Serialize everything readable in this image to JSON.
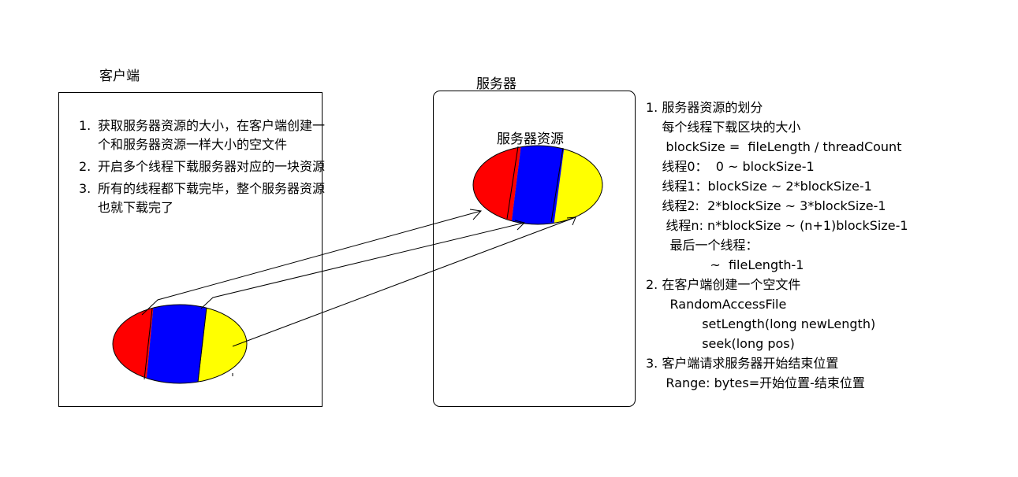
{
  "client": {
    "title": "客户端",
    "steps": [
      {
        "num": "1.",
        "text": "获取服务器资源的大小，在客户端创建一个和服务器资源一样大小的空文件"
      },
      {
        "num": "2.",
        "text": "开启多个线程下载服务器对应的一块资源"
      },
      {
        "num": "3.",
        "text": "所有的线程都下载完毕，整个服务器资源也就下载完了"
      }
    ]
  },
  "server": {
    "title": "服务器",
    "resource_label": "服务器资源"
  },
  "colors": {
    "segment1": "#ff0000",
    "segment2": "#0000ff",
    "segment3": "#ffff00"
  },
  "notes": [
    "1. 服务器资源的划分",
    "    每个线程下载区块的大小",
    "     blockSize =  fileLength / threadCount",
    "    线程0：  0 ~ blockSize-1",
    "    线程1：blockSize ~ 2*blockSize-1",
    "    线程2:  2*blockSize ~ 3*blockSize-1",
    "     线程n: n*blockSize ~ (n+1)blockSize-1",
    "      最后一个线程：",
    "                ~  fileLength-1",
    "2. 在客户端创建一个空文件",
    "      RandomAccessFile",
    "              setLength(long newLength)",
    "              seek(long pos)",
    "3. 客户端请求服务器开始结束位置",
    "     Range: bytes=开始位置-结束位置"
  ]
}
